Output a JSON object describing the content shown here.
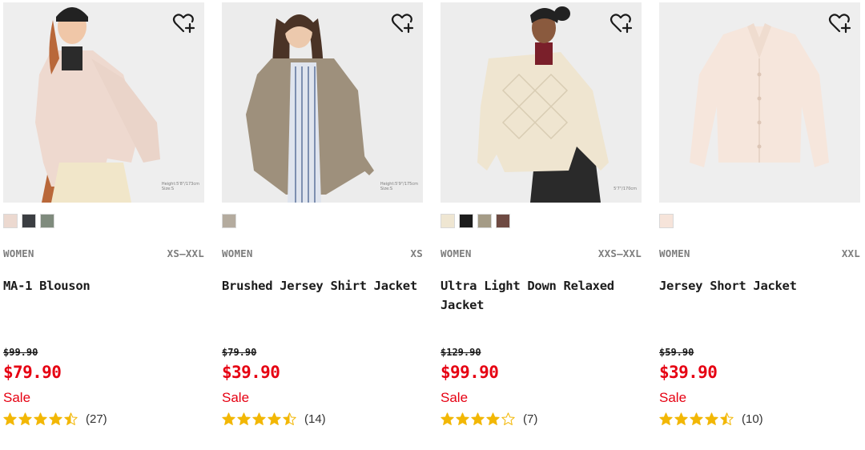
{
  "colors": {
    "sale_red": "#e60012",
    "star_gold": "#f2b705",
    "meta_gray": "#7d7d7d"
  },
  "products": [
    {
      "gender": "WOMEN",
      "sizes": "XS–XXL",
      "name": "MA-1 Blouson",
      "original_price": "$99.90",
      "price": "$79.90",
      "sale_label": "Sale",
      "rating": 4.5,
      "review_count": "(27)",
      "image_caption": "Height:5'8\"/173cm\nSize:S",
      "colors": [
        "#ecd9d0",
        "#3b3e42",
        "#7f8b7d"
      ]
    },
    {
      "gender": "WOMEN",
      "sizes": "XS",
      "name": "Brushed Jersey Shirt Jacket",
      "original_price": "$79.90",
      "price": "$39.90",
      "sale_label": "Sale",
      "rating": 4.5,
      "review_count": "(14)",
      "image_caption": "Height:5'9\"/175cm\nSize:S",
      "colors": [
        "#b4ab9e"
      ]
    },
    {
      "gender": "WOMEN",
      "sizes": "XXS–XXL",
      "name": "Ultra Light Down Relaxed Jacket",
      "original_price": "$129.90",
      "price": "$99.90",
      "sale_label": "Sale",
      "rating": 4,
      "review_count": "(7)",
      "image_caption": "5'7\"/170cm",
      "colors": [
        "#efe6d2",
        "#1c1c1c",
        "#a49b86",
        "#6e4a42"
      ]
    },
    {
      "gender": "WOMEN",
      "sizes": "XXL",
      "name": "Jersey Short Jacket",
      "original_price": "$59.90",
      "price": "$39.90",
      "sale_label": "Sale",
      "rating": 4.5,
      "review_count": "(10)",
      "image_caption": "",
      "colors": [
        "#f6e4da"
      ]
    }
  ]
}
